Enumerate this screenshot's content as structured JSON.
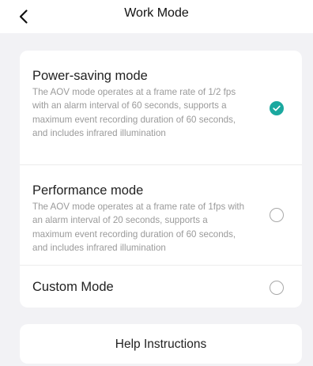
{
  "header": {
    "back_icon": "chevron-left-icon",
    "title": "Work Mode"
  },
  "modes": [
    {
      "title": "Power-saving mode",
      "description": "The AOV mode operates at a frame rate of 1/2 fps with an alarm interval of 60 seconds, supports a maximum event recording duration of 60 seconds, and includes infrared illumination",
      "selected": true
    },
    {
      "title": "Performance mode",
      "description": "The AOV mode operates at a frame rate of 1fps with an alarm interval of 20 seconds, supports a maximum event recording duration of 60 seconds, and includes infrared illumination",
      "selected": false
    },
    {
      "title": "Custom Mode",
      "selected": false
    }
  ],
  "help": {
    "label": "Help Instructions"
  },
  "colors": {
    "accent": "#1aa89f",
    "background": "#f2f2f5",
    "card": "#ffffff",
    "description_text": "#9a9a9a"
  }
}
